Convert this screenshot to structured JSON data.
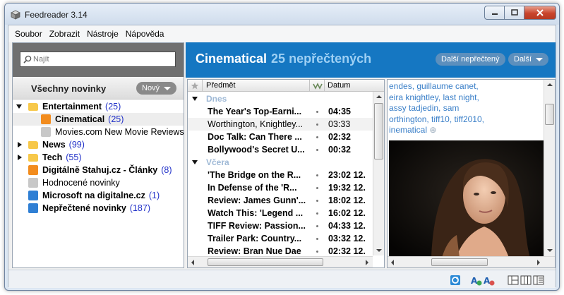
{
  "window": {
    "title": "Feedreader 3.14"
  },
  "menu": [
    "Soubor",
    "Zobrazit",
    "Nástroje",
    "Nápověda"
  ],
  "search": {
    "placeholder": "Najít"
  },
  "feeds_panel": {
    "title": "Všechny novinky",
    "filter_label": "Nový",
    "tree": [
      {
        "label": "Entertainment",
        "count": "(25)",
        "bold": true,
        "expanded": true,
        "icon": "folder-icon",
        "level": 0
      },
      {
        "label": "Cinematical",
        "count": "(25)",
        "bold": true,
        "selected": true,
        "icon": "rss-icon",
        "level": 1
      },
      {
        "label": "Movies.com New Movie Reviews",
        "count": "",
        "bold": false,
        "icon": "rss-icon-gray",
        "level": 1
      },
      {
        "label": "News",
        "count": "(99)",
        "bold": true,
        "expanded": false,
        "icon": "folder-feed-icon",
        "level": 0
      },
      {
        "label": "Tech",
        "count": "(55)",
        "bold": true,
        "expanded": false,
        "icon": "folder-feed-icon",
        "level": 0
      },
      {
        "label": "Digitálně Stahuj.cz - Články",
        "count": "(8)",
        "bold": true,
        "icon": "rss-icon",
        "level": 0
      },
      {
        "label": "Hodnocené novinky",
        "count": "",
        "bold": false,
        "icon": "rss-icon-gray",
        "level": 0
      },
      {
        "label": "Microsoft na digitalne.cz",
        "count": "(1)",
        "bold": true,
        "icon": "rss-icon-blue",
        "level": 0
      },
      {
        "label": "Nepřečtené novinky",
        "count": "(187)",
        "bold": true,
        "icon": "rss-icon-blue",
        "level": 0
      }
    ]
  },
  "feed_header": {
    "name": "Cinematical",
    "unread": "25 nepřečtených",
    "next_unread_label": "Další nepřečtený",
    "next_label": "Další"
  },
  "list": {
    "columns": {
      "subject": "Předmět",
      "date": "Datum"
    },
    "groups": [
      {
        "label": "Dnes",
        "items": [
          {
            "subject": "The Year's Top-Earni...",
            "date": "04:35",
            "bold": true
          },
          {
            "subject": "Worthington, Knightley...",
            "date": "03:33",
            "bold": false
          },
          {
            "subject": "Doc Talk: Can There ...",
            "date": "02:32",
            "bold": true
          },
          {
            "subject": "Bollywood's Secret U...",
            "date": "00:32",
            "bold": true
          }
        ]
      },
      {
        "label": "Včera",
        "items": [
          {
            "subject": "'The Bridge on the R...",
            "date": "23:02 12.",
            "bold": true
          },
          {
            "subject": "In Defense of the 'R...",
            "date": "19:32 12.",
            "bold": true
          },
          {
            "subject": "Review: James Gunn'...",
            "date": "18:02 12.",
            "bold": true
          },
          {
            "subject": "Watch This: 'Legend ...",
            "date": "16:02 12.",
            "bold": true
          },
          {
            "subject": "TIFF Review: Passion...",
            "date": "04:33 12.",
            "bold": true
          },
          {
            "subject": "Trailer Park: Country...",
            "date": "03:32 12.",
            "bold": true
          },
          {
            "subject": "Review: Bran Nue Dae",
            "date": "02:32 12.",
            "bold": true
          }
        ]
      }
    ]
  },
  "preview": {
    "tags": [
      "endes, guillaume canet,",
      "eira knightley, last night,",
      "assy tadjedin, sam",
      "orthington, tiff10, tiff2010,",
      "inematical"
    ]
  },
  "colors": {
    "header_blue": "#1577c2",
    "unread_count": "#9ed0f4",
    "link_blue": "#3a7fc8",
    "count_blue": "#2030c8",
    "group_label": "#9fb9d6"
  }
}
